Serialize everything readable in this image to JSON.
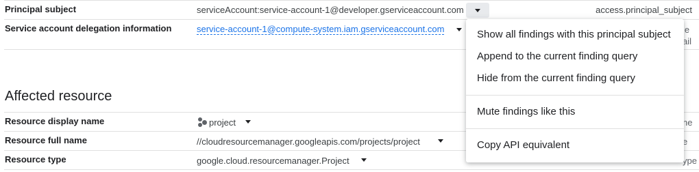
{
  "access_section": {
    "rows": [
      {
        "label": "Principal subject",
        "value": "serviceAccount:service-account-1@developer.gserviceaccount.com",
        "field_key": "access.principal_subject"
      },
      {
        "label": "Service account delegation information",
        "value": "service-account-1@compute-system.iam.gserviceaccount.com",
        "clipped_right": "le",
        "clipped_right_2": "ail"
      }
    ]
  },
  "affected_resource": {
    "title": "Affected resource",
    "rows": [
      {
        "label": "Resource display name",
        "value": "project",
        "clipped_right": "ne"
      },
      {
        "label": "Resource full name",
        "value": "//cloudresourcemanager.googleapis.com/projects/project",
        "clipped_right": "e"
      },
      {
        "label": "Resource type",
        "value": "google.cloud.resourcemanager.Project",
        "clipped_right": "ype"
      }
    ]
  },
  "context_menu": {
    "items": [
      "Show all findings with this principal subject",
      "Append to the current finding query",
      "Hide from the current finding query",
      "Mute findings like this",
      "Copy API equivalent"
    ]
  },
  "icons": {
    "dropdown": "caret-down-icon",
    "project": "project-icon"
  }
}
